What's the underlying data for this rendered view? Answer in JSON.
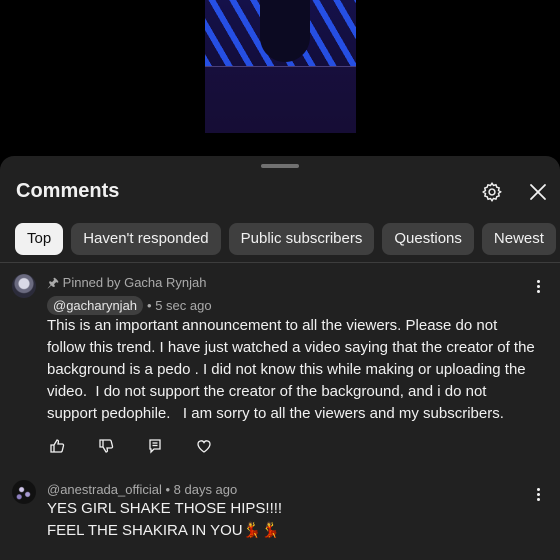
{
  "comments_sheet": {
    "title": "Comments",
    "icons": {
      "settings": "gear-icon",
      "close": "close-icon"
    },
    "chips": [
      {
        "label": "Top",
        "active": true
      },
      {
        "label": "Haven't responded",
        "active": false
      },
      {
        "label": "Public subscribers",
        "active": false
      },
      {
        "label": "Questions",
        "active": false
      },
      {
        "label": "Newest",
        "active": false
      }
    ]
  },
  "comments": [
    {
      "pinned": "Pinned by Gacha Rynjah",
      "author": "@gacharynjah",
      "time": "• 5 sec ago",
      "text": "This is an important announcement to all the viewers. Please do not follow this trend. I have just watched a video saying that the creator of the background is a pedo . I did not know this while making or uploading the video.  I do not support the creator of the background, and i do not support pedophile.   I am sorry to all the viewers and my subscribers."
    },
    {
      "author_time": "@anestrada_official • 8 days ago",
      "text_line1": "YES GIRL SHAKE THOSE HIPS!!!!",
      "text_line2": "FEEL THE SHAKIRA IN YOU💃💃"
    }
  ],
  "colors": {
    "sheet_bg": "#212121",
    "chip_bg": "#3f3f3f",
    "chip_active_bg": "#f1f1f1",
    "secondary_text": "#aaaaaa"
  }
}
